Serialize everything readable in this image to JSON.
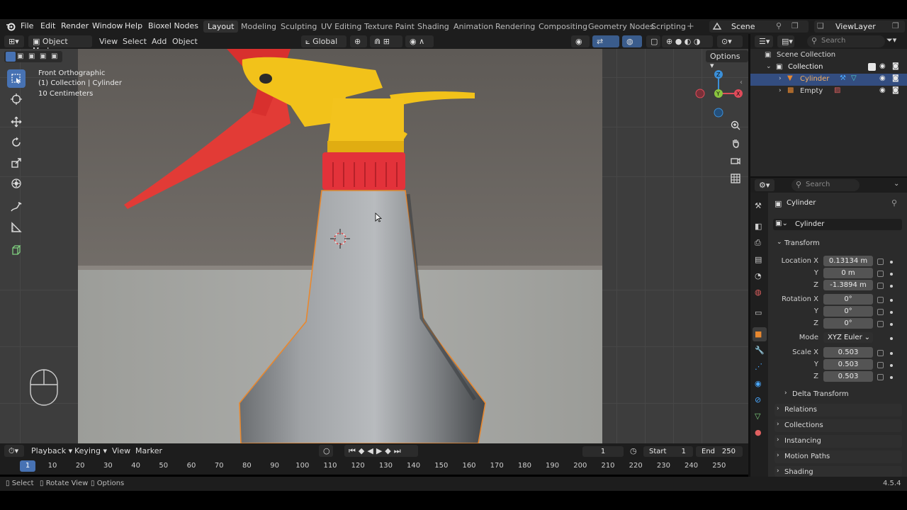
{
  "menu": {
    "items": [
      "File",
      "Edit",
      "Render",
      "Window",
      "Help",
      "Bioxel Nodes"
    ],
    "workspaces": [
      "Layout",
      "Modeling",
      "Sculpting",
      "UV Editing",
      "Texture Paint",
      "Shading",
      "Animation",
      "Rendering",
      "Compositing",
      "Geometry Nodes",
      "Scripting"
    ],
    "active_workspace": "Layout",
    "scene": "Scene",
    "view_layer": "ViewLayer"
  },
  "viewport_header": {
    "mode": "Object Mode",
    "menus": [
      "View",
      "Select",
      "Add",
      "Object"
    ],
    "orientation": "Global",
    "options": "Options"
  },
  "viewport": {
    "view_name": "Front Orthographic",
    "collection_info": "(1) Collection | Cylinder",
    "scale_info": "10 Centimeters"
  },
  "timeline": {
    "menus": [
      "Playback",
      "Keying",
      "View",
      "Marker"
    ],
    "current_frame": "1",
    "start_label": "Start",
    "start": "1",
    "end_label": "End",
    "end": "250",
    "ticks": [
      "1",
      "10",
      "20",
      "30",
      "40",
      "50",
      "60",
      "70",
      "80",
      "90",
      "100",
      "110",
      "120",
      "130",
      "140",
      "150",
      "160",
      "170",
      "180",
      "190",
      "200",
      "210",
      "220",
      "230",
      "240",
      "250"
    ]
  },
  "status": {
    "select": "Select",
    "rotate": "Rotate View",
    "options": "Options",
    "version": "4.5.4"
  },
  "outliner": {
    "search_placeholder": "Search",
    "scene_collection": "Scene Collection",
    "collection": "Collection",
    "objects": [
      "Cylinder",
      "Empty"
    ]
  },
  "properties": {
    "search_placeholder": "Search",
    "object_name": "Cylinder",
    "data_name": "Cylinder",
    "transform_label": "Transform",
    "location": {
      "label": "Location X",
      "x": "0.13134 m",
      "y": "0 m",
      "z": "-1.3894 m"
    },
    "rotation": {
      "label": "Rotation X",
      "x": "0°",
      "y": "0°",
      "z": "0°"
    },
    "mode_label": "Mode",
    "mode": "XYZ Euler",
    "scale": {
      "label": "Scale X",
      "x": "0.503",
      "y": "0.503",
      "z": "0.503"
    },
    "axis_y": "Y",
    "axis_z": "Z",
    "panels": [
      "Delta Transform",
      "Relations",
      "Collections",
      "Instancing",
      "Motion Paths",
      "Shading"
    ]
  },
  "colors": {
    "accent": "#4772b3",
    "selected_outline": "#e8882f",
    "axis_x": "#e04b5a",
    "axis_y": "#8ac43f",
    "axis_z": "#3b8fd8"
  }
}
